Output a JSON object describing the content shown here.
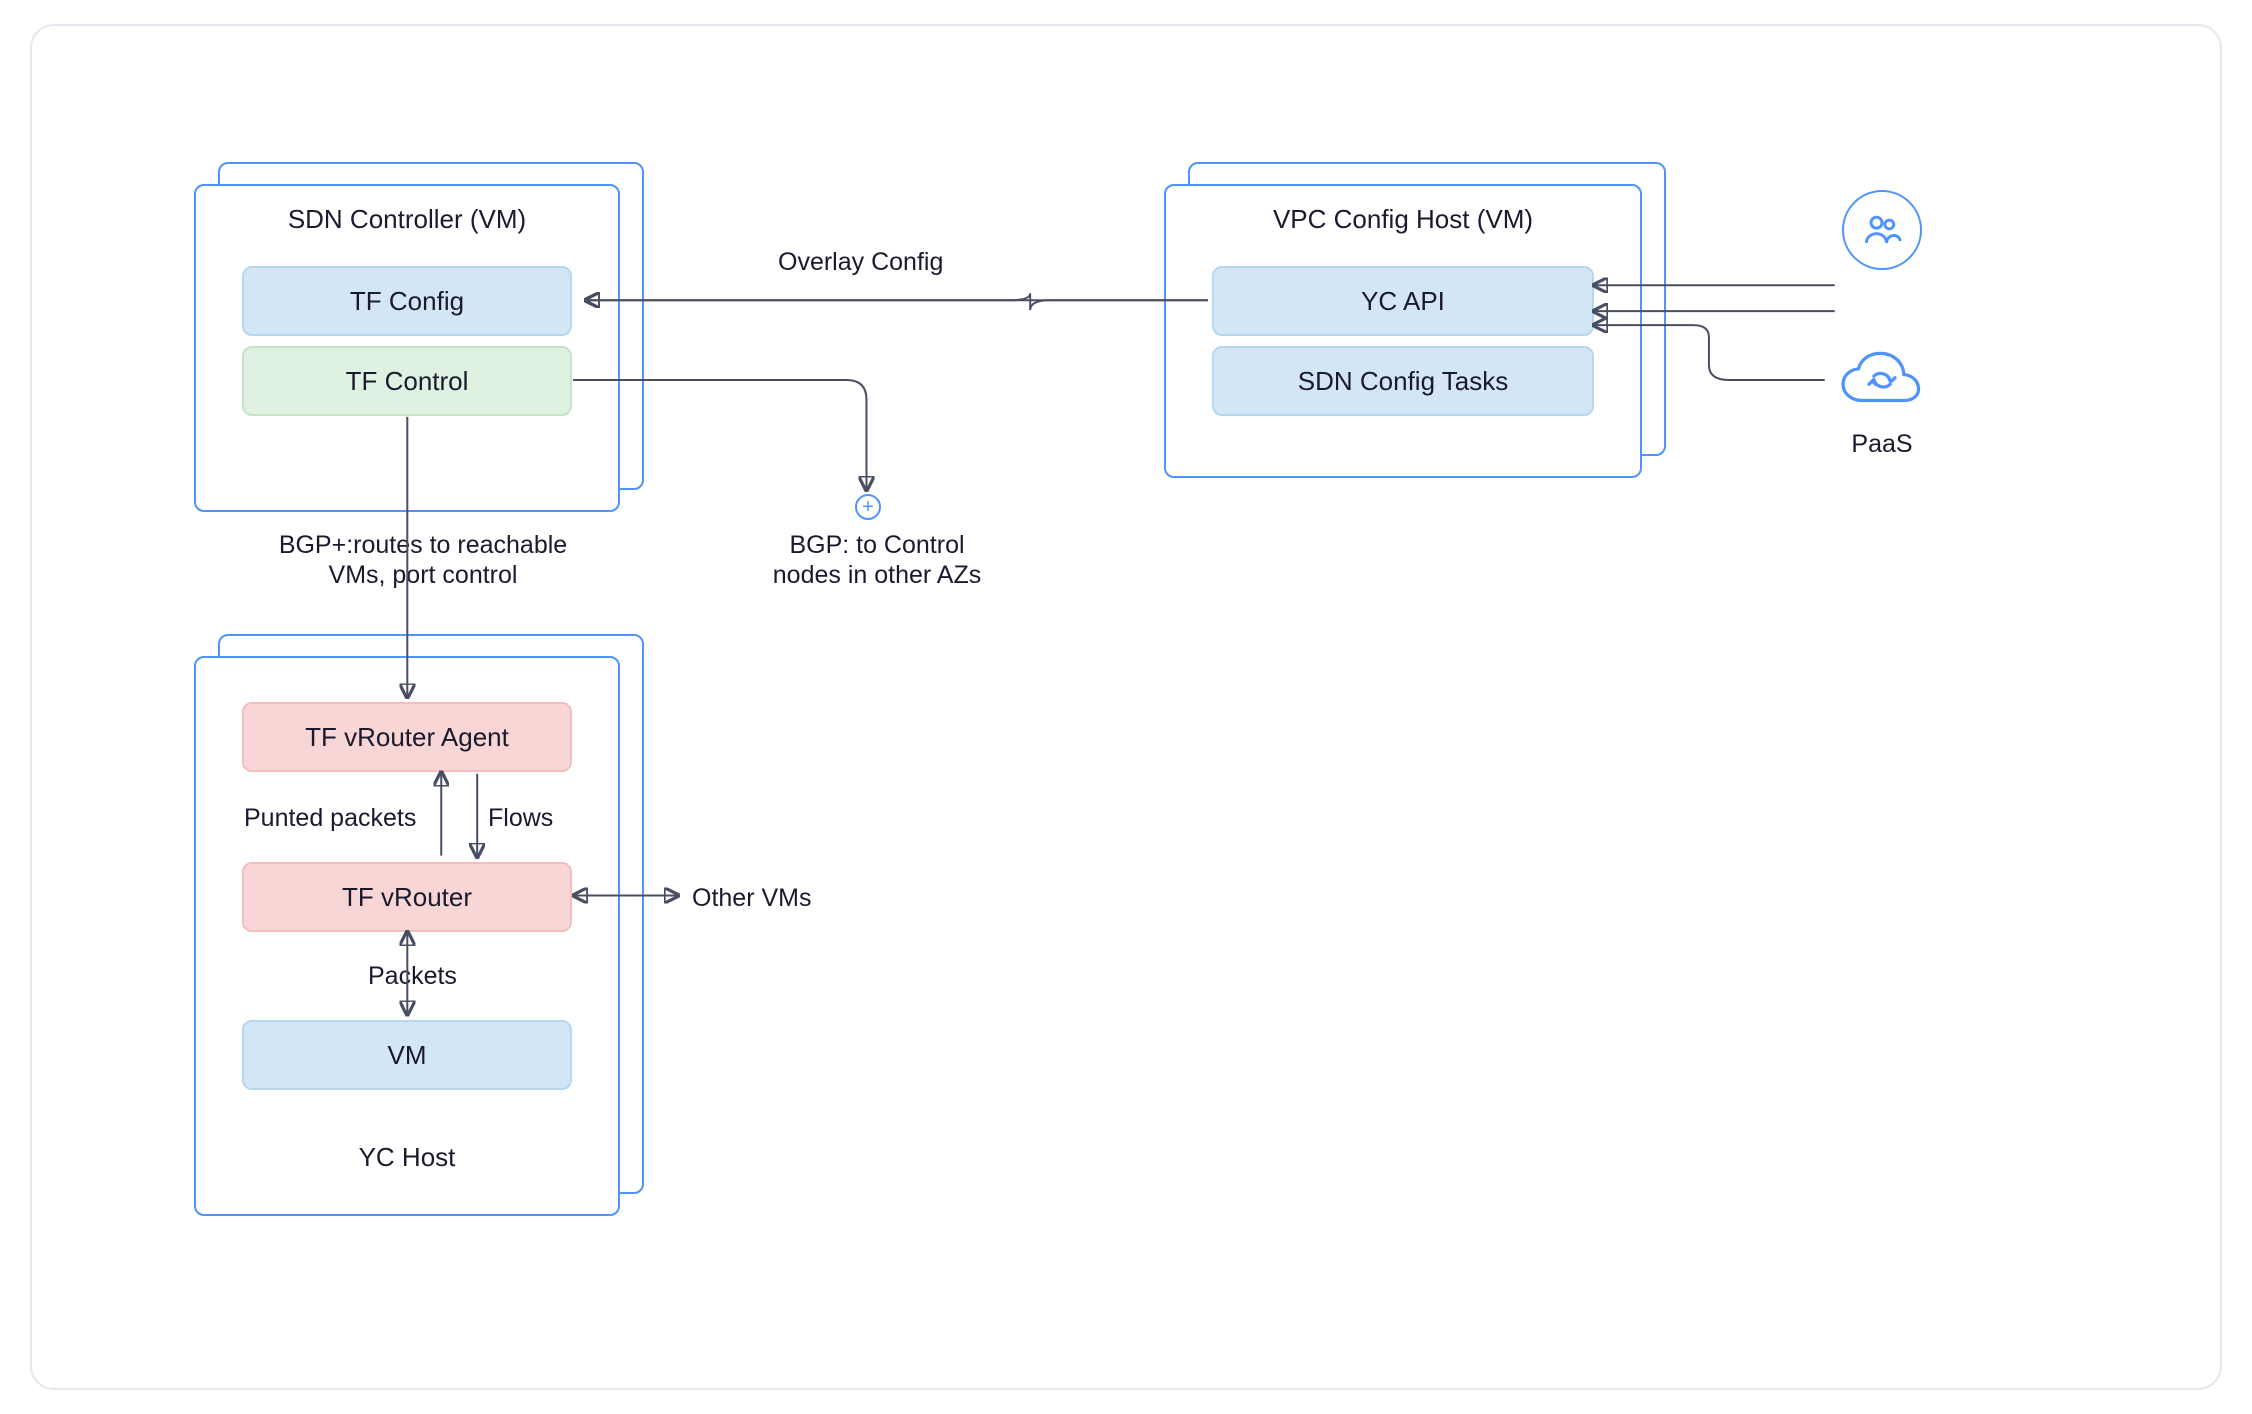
{
  "colors": {
    "accent": "#4f93ff",
    "edge": "#4a4e62",
    "box_blue_bg": "#d3e6f6",
    "box_green_bg": "#dff1e1",
    "box_red_bg": "#f8d6d6"
  },
  "sdn_controller": {
    "title": "SDN Controller (VM)",
    "tf_config": "TF Config",
    "tf_control": "TF Control"
  },
  "vpc_host": {
    "title": "VPC Config Host (VM)",
    "yc_api": "YC API",
    "sdn_tasks": "SDN Config Tasks"
  },
  "yc_host": {
    "title": "YC Host",
    "vrouter_agent": "TF vRouter Agent",
    "vrouter": "TF vRouter",
    "vm": "VM"
  },
  "labels": {
    "overlay_config": "Overlay Config",
    "bgp_control": "BGP: to Control nodes in other AZs",
    "bgp_routes": "BGP+:routes to reachable VMs, port control",
    "punted_packets": "Punted packets",
    "flows": "Flows",
    "packets": "Packets",
    "other_vms": "Other VMs",
    "paas": "PaaS"
  },
  "icons": {
    "users": "users-icon",
    "cloud_sync": "cloud-sync-icon",
    "plus": "plus-icon"
  }
}
